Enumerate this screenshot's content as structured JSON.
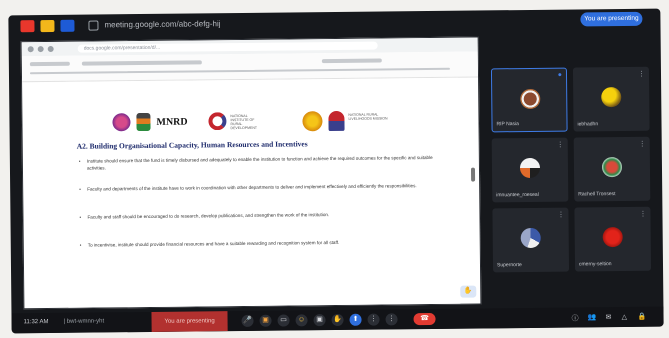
{
  "top_bar": {
    "title": "meeting.google.com/abc-defg-hij",
    "right_button": "You are presenting"
  },
  "browser": {
    "address": "docs.google.com/presentation/d/..."
  },
  "slide": {
    "logo_mnrd": "MNRD",
    "logo_org_text": "NATIONAL INSTITUTE OF RURAL DEVELOPMENT",
    "logo_org2_text": "NATIONAL RURAL LIVELIHOODS MISSION",
    "heading": "A2. Building Organisational Capacity, Human Resources and Incentives",
    "bullets": [
      "Institute should ensure that the fund is timely disbursed and adequately to enable the institution to function and achieve the required outcomes for the specific and suitable activities.",
      "Faculty and departments of the institute have to work in coordination with other departments to deliver and implement effectively and efficiently the responsibilities.",
      "Faculty and staff should be encouraged to do research, develop publications, and strengthen the work of the institution.",
      "To incentivise, institute should provide financial resources and have a suitable rewarding and recognition system for all staff."
    ],
    "badge": "✋"
  },
  "participants": [
    {
      "name": "RIP Nasia",
      "mic": "●"
    },
    {
      "name": "iebhadhn",
      "mic": "⋮"
    },
    {
      "name": "imnuantee_roeseal",
      "mic": "⋮"
    },
    {
      "name": "Rachell Tronsest",
      "mic": "⋮"
    },
    {
      "name": "Supernorte",
      "mic": "⋮"
    },
    {
      "name": "cmerny-seltion",
      "mic": "⋮"
    }
  ],
  "bottom_bar": {
    "time": "11:32 AM",
    "code": "| bwt-wmnn-yht",
    "presenting": "You are presenting",
    "controls": {
      "mic": "🎤",
      "cam": "▣",
      "captions": "▭",
      "emoji": "☺",
      "present": "▣",
      "raise": "✋",
      "share": "⬆",
      "more": "⋮",
      "more2": "⋮",
      "leave": "☎"
    },
    "side": {
      "info": "ⓘ",
      "people": "👥",
      "chat": "✉",
      "activities": "△",
      "lock": "🔒"
    }
  },
  "colors": {
    "accent": "#2f6fde",
    "leave": "#e23b32",
    "presenting": "#b2312f"
  }
}
